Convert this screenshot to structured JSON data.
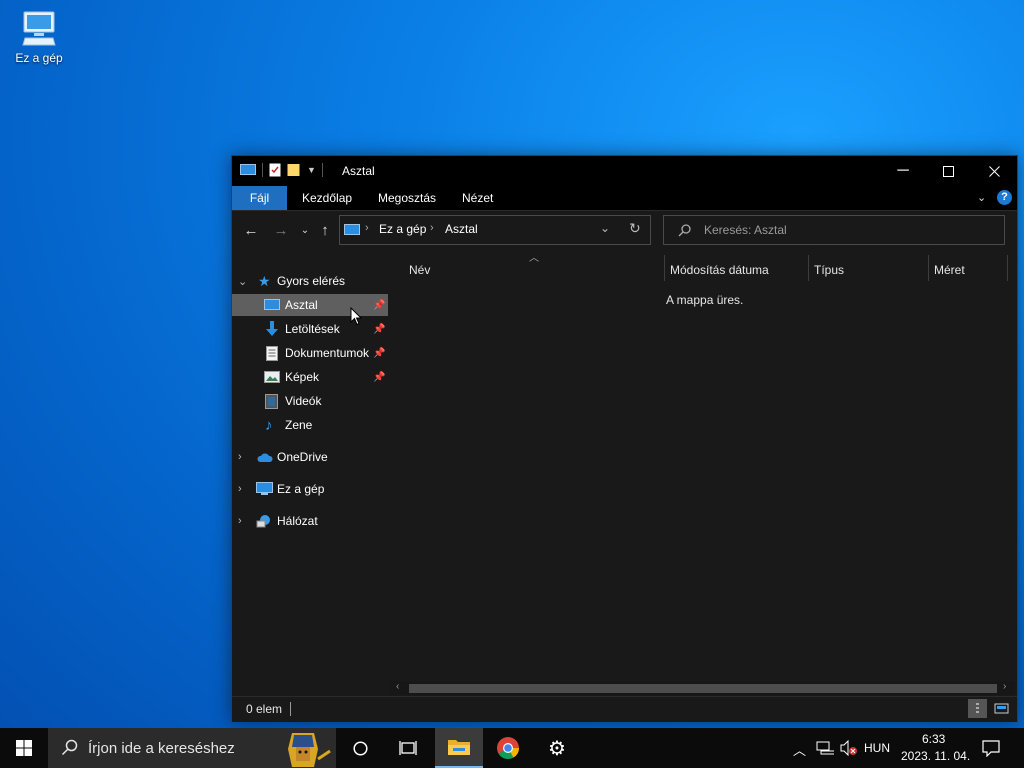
{
  "desktop": {
    "icon_label": "Ez a gép"
  },
  "window": {
    "title": "Asztal",
    "controls": [
      "minimize",
      "maximize",
      "close"
    ],
    "ribbon_tabs": [
      "Fájl",
      "Kezdőlap",
      "Megosztás",
      "Nézet"
    ],
    "address": {
      "segments": [
        "Ez a gép",
        "Asztal"
      ]
    },
    "search_placeholder": "Keresés: Asztal",
    "sidebar": {
      "quick_access": "Gyors elérés",
      "quick_items": [
        {
          "label": "Asztal",
          "icon": "desktop-icon",
          "pinned": true,
          "selected": true
        },
        {
          "label": "Letöltések",
          "icon": "download-icon",
          "pinned": true
        },
        {
          "label": "Dokumentumok",
          "icon": "document-icon",
          "pinned": true
        },
        {
          "label": "Képek",
          "icon": "pictures-icon",
          "pinned": true
        },
        {
          "label": "Videók",
          "icon": "video-icon",
          "pinned": false
        },
        {
          "label": "Zene",
          "icon": "music-icon",
          "pinned": false
        }
      ],
      "roots": [
        {
          "label": "OneDrive",
          "icon": "cloud-icon"
        },
        {
          "label": "Ez a gép",
          "icon": "computer-icon"
        },
        {
          "label": "Hálózat",
          "icon": "network-icon"
        }
      ]
    },
    "columns": [
      "Név",
      "Módosítás dátuma",
      "Típus",
      "Méret"
    ],
    "empty_message": "A mappa üres.",
    "status": "0 elem"
  },
  "taskbar": {
    "search_placeholder": "Írjon ide a kereséshez",
    "language": "HUN",
    "time": "6:33",
    "date": "2023. 11. 04."
  },
  "colors": {
    "accent": "#1e6fc0",
    "window_bg": "#191919",
    "titlebar": "#000000"
  }
}
